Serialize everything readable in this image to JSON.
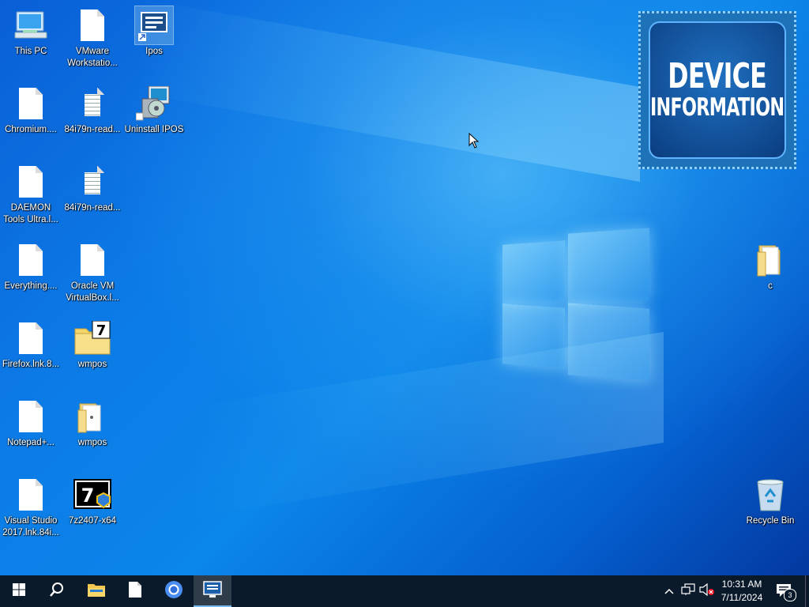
{
  "desktop": {
    "icons": [
      {
        "id": "this-pc",
        "label": "This PC"
      },
      {
        "id": "vmware",
        "label": "VMware Workstatio..."
      },
      {
        "id": "ipos",
        "label": "Ipos"
      },
      {
        "id": "chromium",
        "label": "Chromium...."
      },
      {
        "id": "readme1",
        "label": "84i79n-read..."
      },
      {
        "id": "uninstall-ipos",
        "label": "Uninstall IPOS"
      },
      {
        "id": "daemon",
        "label": "DAEMON Tools Ultra.l..."
      },
      {
        "id": "readme2",
        "label": "84i79n-read..."
      },
      {
        "id": "everything",
        "label": "Everything...."
      },
      {
        "id": "oracle-vm",
        "label": "Oracle VM VirtualBox.l..."
      },
      {
        "id": "firefox",
        "label": "Firefox.lnk.8..."
      },
      {
        "id": "wmpos-1",
        "label": "wmpos"
      },
      {
        "id": "notepadpp",
        "label": "Notepad+..."
      },
      {
        "id": "wmpos-2",
        "label": "wmpos"
      },
      {
        "id": "visual-studio",
        "label": "Visual Studio 2017.lnk.84i..."
      },
      {
        "id": "7z",
        "label": "7z2407-x64"
      },
      {
        "id": "folder-c",
        "label": "c"
      },
      {
        "id": "recycle-bin",
        "label": "Recycle Bin"
      }
    ],
    "widget": {
      "line1": "DEVICE",
      "line2": "INFORMATION"
    }
  },
  "taskbar": {
    "items": [
      {
        "name": "start",
        "icon": "windows-logo-icon"
      },
      {
        "name": "search",
        "icon": "search-icon"
      },
      {
        "name": "file-explorer",
        "icon": "folder-icon"
      },
      {
        "name": "notepad",
        "icon": "document-icon"
      },
      {
        "name": "chromium",
        "icon": "chromium-icon"
      },
      {
        "name": "ipos",
        "icon": "ipos-icon",
        "active": true
      }
    ],
    "clock": {
      "time": "10:31 AM",
      "date": "7/11/2024"
    },
    "notification_count": "3"
  },
  "colors": {
    "taskbar": "#0b1a2a",
    "accent": "#76b9ed",
    "desktop": "#0c7ae6"
  }
}
